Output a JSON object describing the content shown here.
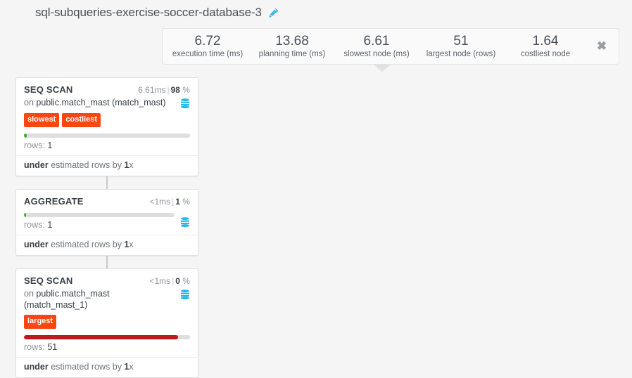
{
  "header": {
    "plan_title": "sql-subqueries-exercise-soccer-database-3",
    "edit_icon": "pencil-icon",
    "edit_icon_color": "#3fb7e8"
  },
  "stats": {
    "close_label": "✖",
    "items": [
      {
        "value": "6.72",
        "label": "execution time (ms)"
      },
      {
        "value": "13.68",
        "label": "planning time (ms)"
      },
      {
        "value": "6.61",
        "label": "slowest node (ms)"
      },
      {
        "value": "51",
        "label": "largest node (rows)"
      },
      {
        "value": "1.64",
        "label": "costliest node"
      }
    ]
  },
  "colors": {
    "badge": "#ff4612",
    "bar_green": "#3aaf2b",
    "bar_red": "#bb1b1b",
    "bar_track": "#dedede",
    "accent_blue": "#3fb7e8",
    "page_background": "#f5f5f5"
  },
  "plan_nodes": [
    {
      "type": "SEQ SCAN",
      "duration": "6.61ms",
      "separator": "|",
      "percent": "98",
      "percent_unit": "%",
      "relation_prefix": "on ",
      "relation": "public.match_mast (match_mast)",
      "db_icon": "database-icon",
      "badges": [
        "slowest",
        "costliest"
      ],
      "bar_fill_percent": 1.5,
      "bar_color_key": "bar_green",
      "rows_prefix": "rows: ",
      "rows_value": "1",
      "footer_bold": "under",
      "footer_text": " estimated rows by ",
      "footer_factor": "1",
      "footer_suffix": "x"
    },
    {
      "type": "AGGREGATE",
      "duration": "<1ms",
      "separator": "|",
      "percent": "1",
      "percent_unit": "%",
      "relation_prefix": "",
      "relation": "",
      "db_icon": "database-icon",
      "badges": [],
      "bar_fill_percent": 1.5,
      "bar_color_key": "bar_green",
      "rows_prefix": "rows: ",
      "rows_value": "1",
      "footer_bold": "under",
      "footer_text": " estimated rows by ",
      "footer_factor": "1",
      "footer_suffix": "x"
    },
    {
      "type": "SEQ SCAN",
      "duration": "<1ms",
      "separator": "|",
      "percent": "0",
      "percent_unit": "%",
      "relation_prefix": "on ",
      "relation": "public.match_mast (match_mast_1)",
      "db_icon": "database-icon",
      "badges": [
        "largest"
      ],
      "bar_fill_percent": 93,
      "bar_color_key": "bar_red",
      "rows_prefix": "rows: ",
      "rows_value": "51",
      "footer_bold": "under",
      "footer_text": " estimated rows by ",
      "footer_factor": "1",
      "footer_suffix": "x"
    }
  ]
}
